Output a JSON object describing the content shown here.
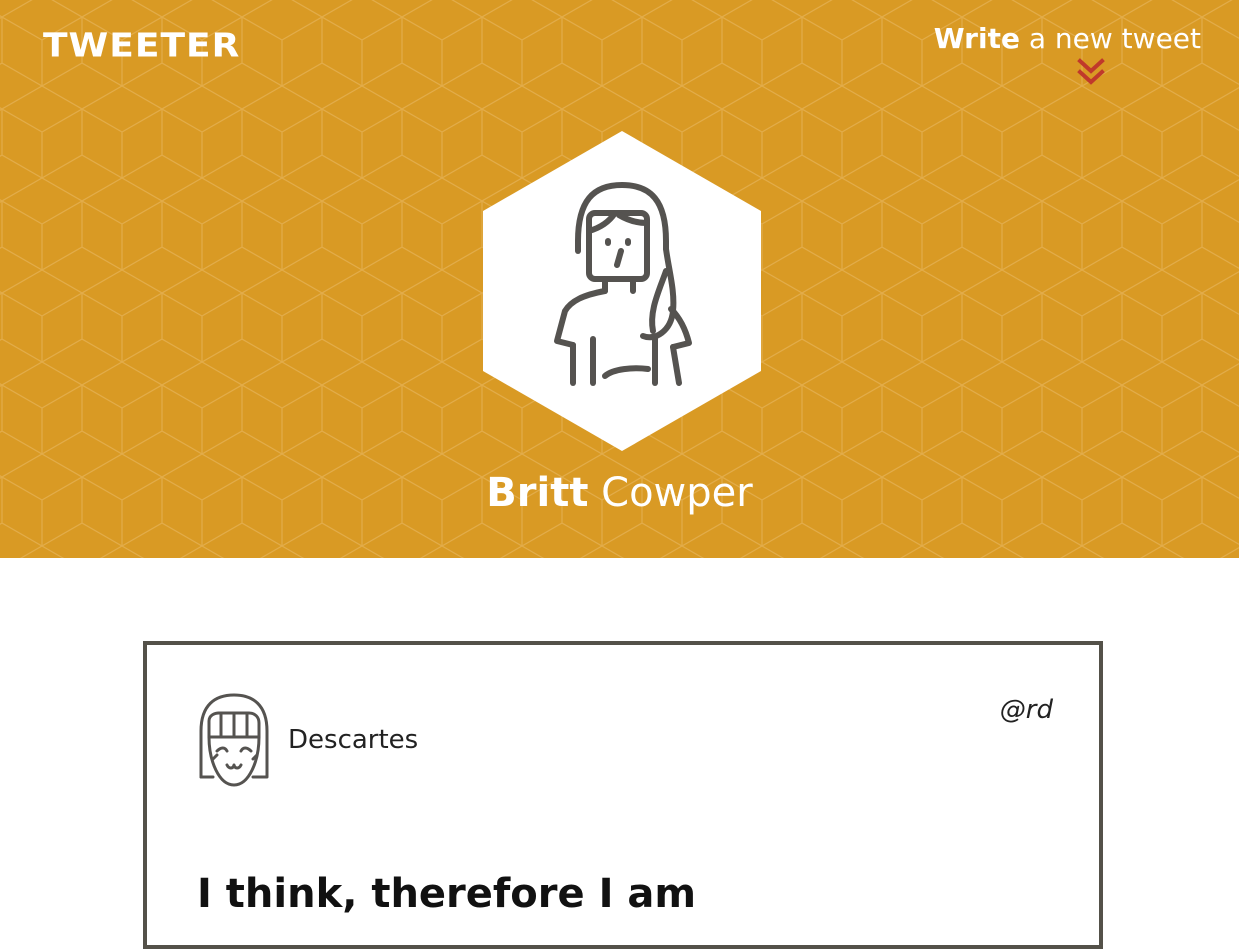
{
  "header": {
    "logo": "TWEETER",
    "write_bold": "Write",
    "write_rest": " a new tweet",
    "background_color": "#d99a24",
    "chevron_color": "#c0392b",
    "chevron_icon": "double-chevron-down-icon"
  },
  "profile": {
    "first_name": "Britt",
    "last_name": " Cowper",
    "avatar_icon": "woman-avatar-icon"
  },
  "tweet": {
    "user_name": "Descartes",
    "handle": "@rd",
    "avatar_icon": "smiling-girl-avatar-icon",
    "text": "I think, therefore I am",
    "border_color": "#545149"
  }
}
